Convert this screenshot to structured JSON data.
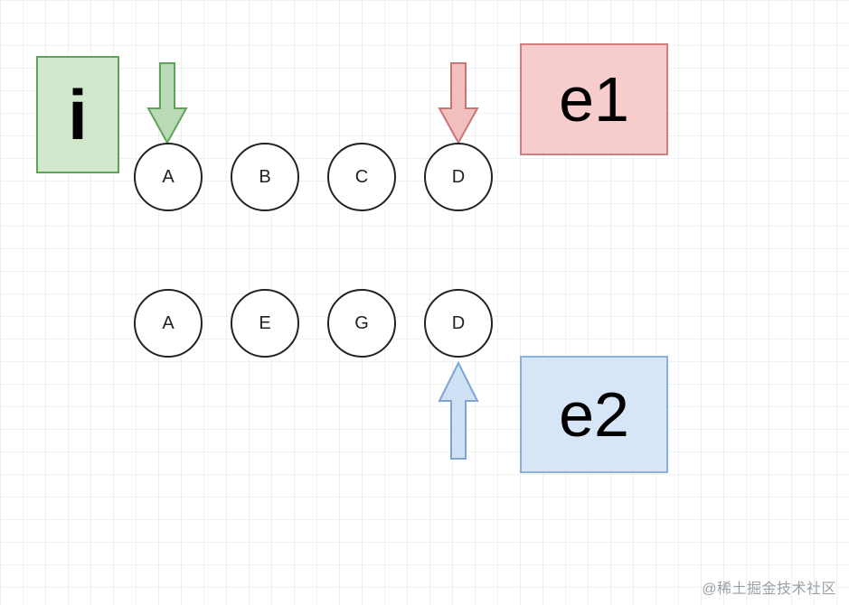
{
  "labels": {
    "i": "i",
    "e1": "e1",
    "e2": "e2"
  },
  "row1": [
    "A",
    "B",
    "C",
    "D"
  ],
  "row2": [
    "A",
    "E",
    "G",
    "D"
  ],
  "arrows": {
    "green": {
      "color_fill": "#b9dab5",
      "color_stroke": "#5ea35a"
    },
    "red": {
      "color_fill": "#f2bfbf",
      "color_stroke": "#ca7575"
    },
    "blue": {
      "color_fill": "#cfe1f5",
      "color_stroke": "#7da6d4"
    }
  },
  "watermark": "@稀土掘金技术社区"
}
